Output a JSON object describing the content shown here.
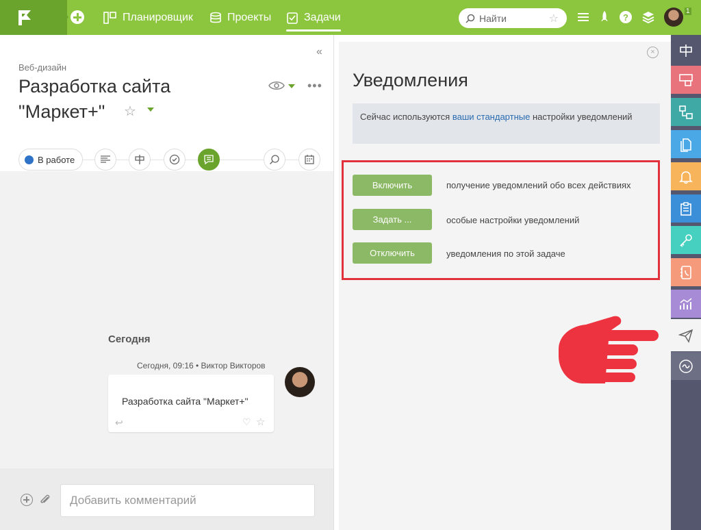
{
  "topbar": {
    "nav": [
      {
        "label": "Планировщик",
        "icon": "planner-icon"
      },
      {
        "label": "Проекты",
        "icon": "projects-icon"
      },
      {
        "label": "Задачи",
        "icon": "tasks-icon"
      }
    ],
    "search_placeholder": "Найти",
    "avatar_badge": "1"
  },
  "task": {
    "breadcrumb": "Веб-дизайн",
    "title": "Разработка сайта \"Маркет+\"",
    "status_label": "В работе",
    "status_color": "#2f73c8"
  },
  "feed": {
    "date_header": "Сегодня",
    "message": {
      "meta": "Сегодня, 09:16 • Виктор Викторов",
      "text": "Разработка сайта \"Маркет+\""
    }
  },
  "composer": {
    "placeholder": "Добавить комментарий"
  },
  "notifications": {
    "title": "Уведомления",
    "info_prefix": "Сейчас используются ",
    "info_link": "ваши стандартные",
    "info_suffix": " настройки уведомлений",
    "actions": [
      {
        "label": "Включить",
        "desc": "получение уведомлений обо всех действиях"
      },
      {
        "label": "Задать ...",
        "desc": "особые настройки уведомлений"
      },
      {
        "label": "Отключить",
        "desc": "уведомления по этой задаче"
      }
    ]
  },
  "colors": {
    "accent": "#8cc63f",
    "accent_dark": "#6aa42c",
    "highlight_red": "#e0313d",
    "sidebar": "#54576e"
  },
  "sidebar": [
    {
      "icon": "signpost-icon",
      "color": "#54576e"
    },
    {
      "icon": "board-icon",
      "color": "#e8737d"
    },
    {
      "icon": "flow-icon",
      "color": "#3fa9a5"
    },
    {
      "icon": "documents-icon",
      "color": "#4aa8e6"
    },
    {
      "icon": "bell-icon",
      "color": "#f7b45a"
    },
    {
      "icon": "clipboard-icon",
      "color": "#3b8fd8"
    },
    {
      "icon": "key-icon",
      "color": "#45d0c0"
    },
    {
      "icon": "phone-book-icon",
      "color": "#f59a7a"
    },
    {
      "icon": "analytics-icon",
      "color": "#a78bd6"
    },
    {
      "icon": "send-icon",
      "color": "#f4f4f4"
    },
    {
      "icon": "wave-icon",
      "color": "#6d7085"
    }
  ]
}
